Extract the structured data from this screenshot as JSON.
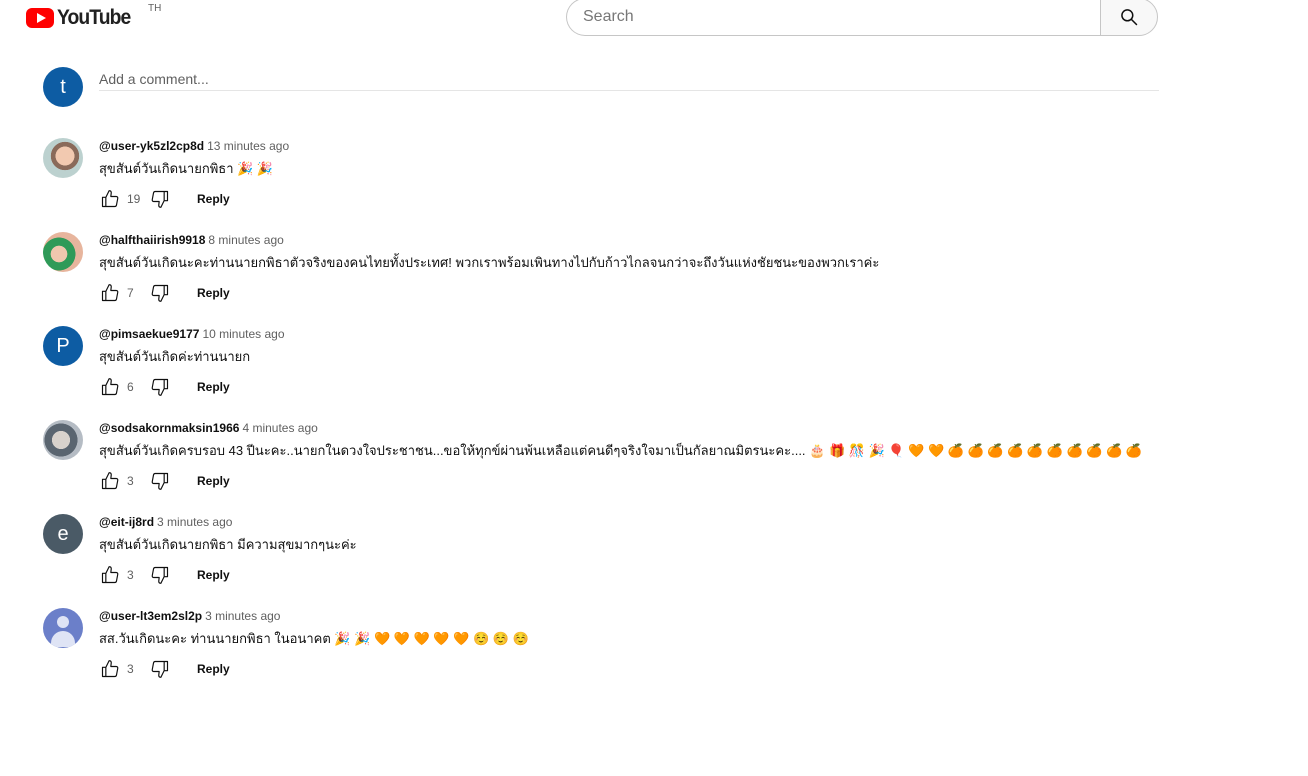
{
  "header": {
    "logo_text": "YouTube",
    "logo_country": "TH",
    "search_placeholder": "Search"
  },
  "add_comment": {
    "avatar_letter": "t",
    "placeholder": "Add a comment..."
  },
  "comments": [
    {
      "author": "@user-yk5zl2cp8d",
      "time": "13 minutes ago",
      "text": "สุขสันต์วันเกิดนายกพิธา 🎉 🎉",
      "likes": "19",
      "reply": "Reply",
      "avatar_letter": ""
    },
    {
      "author": "@halfthaiirish9918",
      "time": "8 minutes ago",
      "text": "สุขสันต์วันเกิดนะคะท่านนายกพิธาตัวจริงของคนไทยทั้งประเทศ! พวกเราพร้อมเพินทางไปกับก้าวไกลจนกว่าจะถึงวันแห่งชัยชนะของพวกเราค่ะ",
      "likes": "7",
      "reply": "Reply",
      "avatar_letter": ""
    },
    {
      "author": "@pimsaekue9177",
      "time": "10 minutes ago",
      "text": "สุขสันต์วันเกิดค่ะท่านนายก",
      "likes": "6",
      "reply": "Reply",
      "avatar_letter": "P"
    },
    {
      "author": "@sodsakornmaksin1966",
      "time": "4 minutes ago",
      "text": "สุขสันต์วันเกิดครบรอบ 43 ปีนะคะ..นายกในดวงใจประชาชน...ขอให้ทุกข์ผ่านพ้นเหลือแต่คนดีๆจริงใจมาเป็นกัลยาณมิตรนะคะ.... 🎂 🎁 🎊 🎉 🎈 🧡 🧡 🍊 🍊 🍊 🍊 🍊 🍊 🍊 🍊 🍊 🍊",
      "likes": "3",
      "reply": "Reply",
      "avatar_letter": ""
    },
    {
      "author": "@eit-ij8rd",
      "time": "3 minutes ago",
      "text": "สุขสันต์วันเกิดนายกพิธา มีความสุขมากๆนะค่ะ",
      "likes": "3",
      "reply": "Reply",
      "avatar_letter": "e"
    },
    {
      "author": "@user-lt3em2sl2p",
      "time": "3 minutes ago",
      "text": "สส.วันเกิดนะคะ ท่านนายกพิธา ในอนาคต 🎉 🎉 🧡 🧡 🧡 🧡 🧡 ☺️ ☺️ ☺️",
      "likes": "3",
      "reply": "Reply",
      "avatar_letter": ""
    }
  ],
  "colors": {
    "brand_red": "#ff0000",
    "avatar_blue": "#0d5ca3",
    "avatar_slate": "#4a5a66",
    "avatar_default": "#6b7fc9"
  }
}
